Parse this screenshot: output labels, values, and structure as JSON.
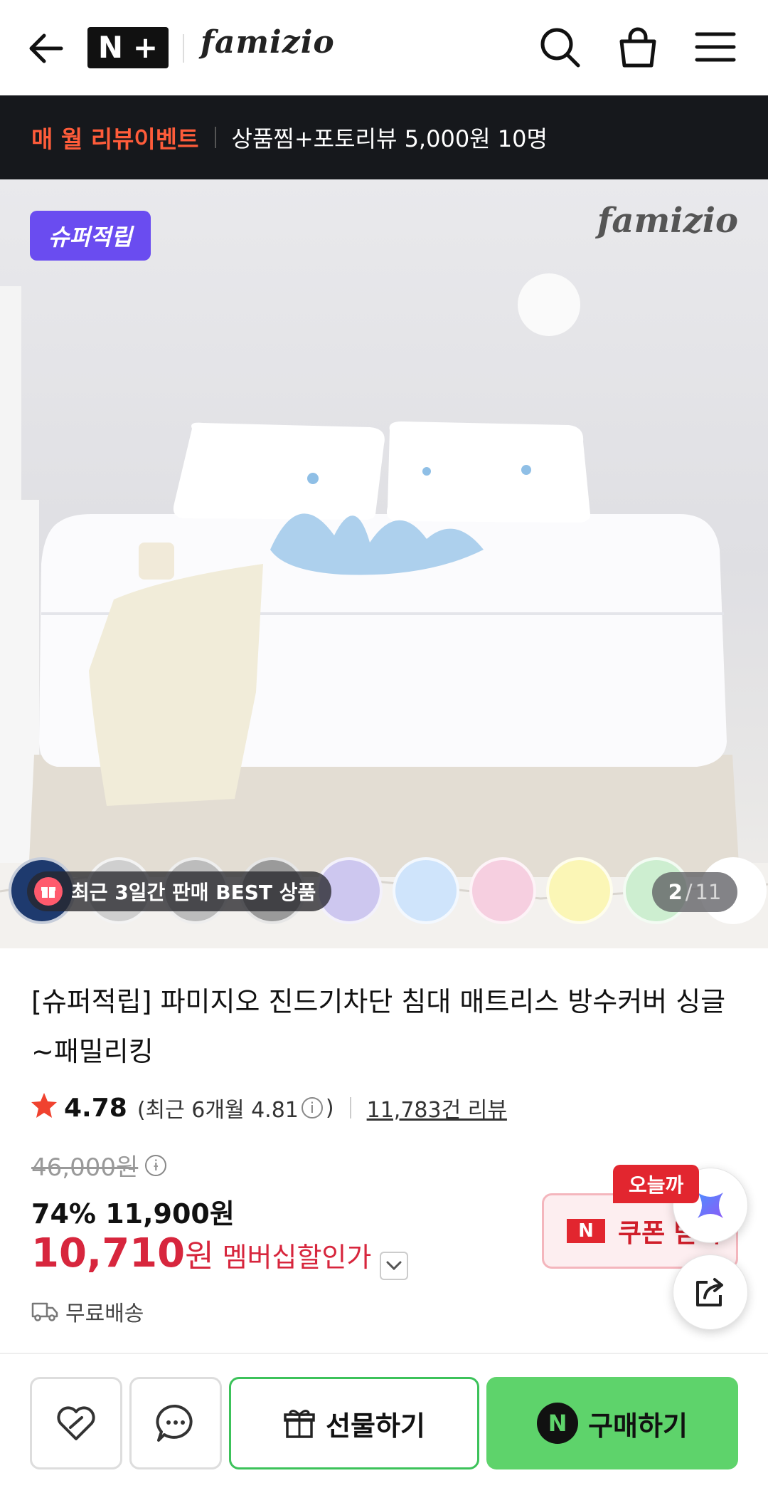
{
  "header": {
    "logo_n": "N",
    "logo_plus": "+",
    "brand": "famizio",
    "icons": [
      "back-arrow-icon",
      "search-icon",
      "cart-icon",
      "menu-icon"
    ]
  },
  "banner": {
    "tag": "매 월 리뷰이벤트",
    "text": "상품찜+포토리뷰 5,000원 10명"
  },
  "hero": {
    "badge": "슈퍼적립",
    "brand": "famizio",
    "best_label": "최근 3일간 판매 BEST 상품",
    "current_index": "2",
    "total": "11",
    "swatch_colors": [
      "#1e3a6e",
      "#cfcfcf",
      "#bcbcbc",
      "#9a9a9a",
      "#cdc7ef",
      "#cfe4fb",
      "#f6cfe0",
      "#fbf6b6",
      "#cdeed0",
      "#ffffff"
    ]
  },
  "product": {
    "title": "[슈퍼적립] 파미지오 진드기차단 침대 매트리스 방수커버 싱글~패밀리킹",
    "rating": "4.78",
    "recent_rating_prefix": "(최근 6개월 4.81",
    "recent_rating_suffix": ")",
    "reviews": "11,783건 리뷰",
    "original_price": "46,000원",
    "discount_rate": "74%",
    "sale_price": "11,900원",
    "member_price": "10,710",
    "member_won": "원",
    "member_label": "멤버십할인가",
    "delivery": "무료배송"
  },
  "coupon": {
    "today_tag": "오늘까",
    "badge": "N",
    "label": "쿠폰 받기"
  },
  "bottom_bar": {
    "gift_label": "선물하기",
    "buy_n": "N",
    "buy_label": "구매하기"
  },
  "colors": {
    "accent_red": "#d7263d",
    "buy_green": "#5ed36b",
    "badge_purple": "#6a4cf0",
    "banner_bg": "#16181c"
  }
}
